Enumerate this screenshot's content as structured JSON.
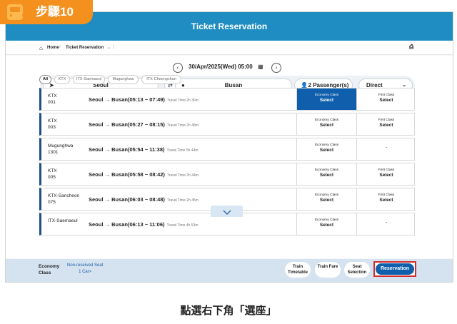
{
  "badge": {
    "label": "步驟10"
  },
  "header": {
    "title": "Ticket Reservation"
  },
  "breadcrumb": {
    "home": "Home",
    "separator": "›",
    "page": "Ticket Reservation",
    "chevron": "⌄"
  },
  "date_bar": {
    "prev": "‹",
    "date": "30/Apr/2025(Wed) 05:00",
    "next": "›"
  },
  "search": {
    "from": "Seoul",
    "to": "Busan",
    "passengers": "2 Passenger(s)",
    "direct": "Direct"
  },
  "filters": [
    "All",
    "KTX",
    "ITX-Saemaeul",
    "Mugunghwa",
    "ITX-Cheongchun"
  ],
  "trains": [
    {
      "name": "KTX",
      "num": "001",
      "route": "Seoul → Busan(05:13 ~ 07:49)",
      "travel": "Travel Time 2h 36m",
      "eco_title": "Economy Class",
      "eco": "Select",
      "first_title": "First Class",
      "first": "Select",
      "eco_selected": true
    },
    {
      "name": "KTX",
      "num": "003",
      "route": "Seoul → Busan(05:27 ~ 08:15)",
      "travel": "Travel Time 2h 48m",
      "eco_title": "Economy Class",
      "eco": "Select",
      "first_title": "First Class",
      "first": "Select",
      "eco_selected": false
    },
    {
      "name": "Mugunghwa",
      "num": "1301",
      "route": "Seoul → Busan(05:54 ~ 11:38)",
      "travel": "Travel Time 5h 44m",
      "eco_title": "Economy Class",
      "eco": "Select",
      "first_title": "",
      "first": "-",
      "eco_selected": false
    },
    {
      "name": "KTX",
      "num": "005",
      "route": "Seoul → Busan(05:58 ~ 08:42)",
      "travel": "Travel Time 2h 44m",
      "eco_title": "Economy Class",
      "eco": "Select",
      "first_title": "First Class",
      "first": "Select",
      "eco_selected": false
    },
    {
      "name": "KTX-Sancheon",
      "num": "075",
      "route": "Seoul → Busan(06:03 ~ 08:48)",
      "travel": "Travel Time 2h 45m",
      "eco_title": "Economy Class",
      "eco": "Select",
      "first_title": "First Class",
      "first": "Select",
      "eco_selected": false
    },
    {
      "name": "ITX-Saemaeul",
      "num": "",
      "route": "Seoul → Busan(06:13 ~ 11:06)",
      "travel": "Travel Time 4h 53m",
      "eco_title": "Economy Class",
      "eco": "Select",
      "first_title": "",
      "first": "-",
      "eco_selected": false
    }
  ],
  "bottom": {
    "class_line1": "Economy",
    "class_line2": "Class",
    "nonres_line1": "Non-reserved Seat",
    "nonres_line2": "1 Car>",
    "timetable": "Train Timetable",
    "fare": "Train Fare",
    "seat": "Seat Selection",
    "reserve": "Reservation"
  },
  "caption": "點選右下角「選座」",
  "colors": {
    "header": "#1f8dc1",
    "badge": "#f4911e",
    "selected": "#0f5fac",
    "highlight": "#d42b2b"
  }
}
